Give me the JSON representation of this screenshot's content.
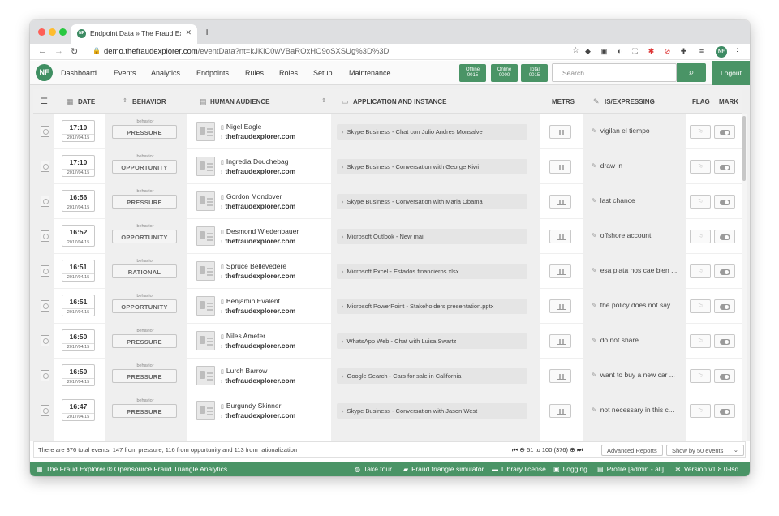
{
  "browser": {
    "tab_title": "Endpoint Data » The Fraud Explorer",
    "tab_favicon": "NF",
    "url_domain": "demo.thefraudexplorer.com",
    "url_path": "/eventData?nt=kJKlC0wVBaROxHO9oSXSUg%3D%3D",
    "profile_initials": "NF"
  },
  "app": {
    "logo": "NF",
    "nav": [
      "Dashboard",
      "Events",
      "Analytics",
      "Endpoints",
      "Rules",
      "Roles",
      "Setup",
      "Maintenance"
    ],
    "stats": [
      {
        "label": "Offline",
        "value": "0015"
      },
      {
        "label": "Online",
        "value": "0000"
      },
      {
        "label": "Total",
        "value": "0015"
      }
    ],
    "search_placeholder": "Search ...",
    "logout_label": "Logout"
  },
  "table": {
    "headers": {
      "date": "DATE",
      "behavior": "BEHAVIOR",
      "audience": "HUMAN AUDIENCE",
      "application": "APPLICATION AND INSTANCE",
      "metrics": "METRS",
      "expressing": "IS/EXPRESSING",
      "flag": "FLAG",
      "mark": "MARK"
    },
    "behavior_caption": "behavior",
    "rows": [
      {
        "time": "17:10",
        "date": "2017/04/15",
        "behavior": "PRESSURE",
        "name": "Nigel Eagle",
        "domain": "thefraudexplorer.com",
        "app": "Skype Business - Chat con Julio Andres Monsalve",
        "expressing": "vigilan el tiempo"
      },
      {
        "time": "17:10",
        "date": "2017/04/15",
        "behavior": "OPPORTUNITY",
        "name": "Ingredia Douchebag",
        "domain": "thefraudexplorer.com",
        "app": "Skype Business - Conversation with George Kiwi",
        "expressing": "draw in"
      },
      {
        "time": "16:56",
        "date": "2017/04/15",
        "behavior": "PRESSURE",
        "name": "Gordon Mondover",
        "domain": "thefraudexplorer.com",
        "app": "Skype Business - Conversation with Maria Obama",
        "expressing": "last chance"
      },
      {
        "time": "16:52",
        "date": "2017/04/15",
        "behavior": "OPPORTUNITY",
        "name": "Desmond Wiedenbauer",
        "domain": "thefraudexplorer.com",
        "app": "Microsoft Outlook - New mail",
        "expressing": "offshore account"
      },
      {
        "time": "16:51",
        "date": "2017/04/15",
        "behavior": "RATIONAL",
        "name": "Spruce Bellevedere",
        "domain": "thefraudexplorer.com",
        "app": "Microsoft Excel - Estados financieros.xlsx",
        "expressing": "esa plata nos cae bien ..."
      },
      {
        "time": "16:51",
        "date": "2017/04/15",
        "behavior": "OPPORTUNITY",
        "name": "Benjamin Evalent",
        "domain": "thefraudexplorer.com",
        "app": "Microsoft PowerPoint - Stakeholders presentation.pptx",
        "expressing": "the policy does not say..."
      },
      {
        "time": "16:50",
        "date": "2017/04/15",
        "behavior": "PRESSURE",
        "name": "Niles Ameter",
        "domain": "thefraudexplorer.com",
        "app": "WhatsApp Web - Chat with Luisa Swartz",
        "expressing": "do not share"
      },
      {
        "time": "16:50",
        "date": "2017/04/15",
        "behavior": "PRESSURE",
        "name": "Lurch Barrow",
        "domain": "thefraudexplorer.com",
        "app": "Google Search - Cars for sale in California",
        "expressing": "want to buy a new car ..."
      },
      {
        "time": "16:47",
        "date": "2017/04/15",
        "behavior": "PRESSURE",
        "name": "Burgundy Skinner",
        "domain": "thefraudexplorer.com",
        "app": "Skype Business - Conversation with Jason West",
        "expressing": "not necessary in this c..."
      }
    ]
  },
  "footer": {
    "summary": "There are 376 total events, 147 from pressure, 116 from opportunity and 113 from rationalization",
    "pager": "51 to 100 (376)",
    "advanced_reports": "Advanced Reports",
    "show_by": "Show by 50 events"
  },
  "statusbar": {
    "brand": "The Fraud Explorer ® Opensource Fraud Triangle Analytics",
    "take_tour": "Take tour",
    "simulator": "Fraud triangle simulator",
    "library": "Library license",
    "logging": "Logging",
    "profile": "Profile [admin - all]",
    "version": "Version v1.8.0-lsd"
  }
}
